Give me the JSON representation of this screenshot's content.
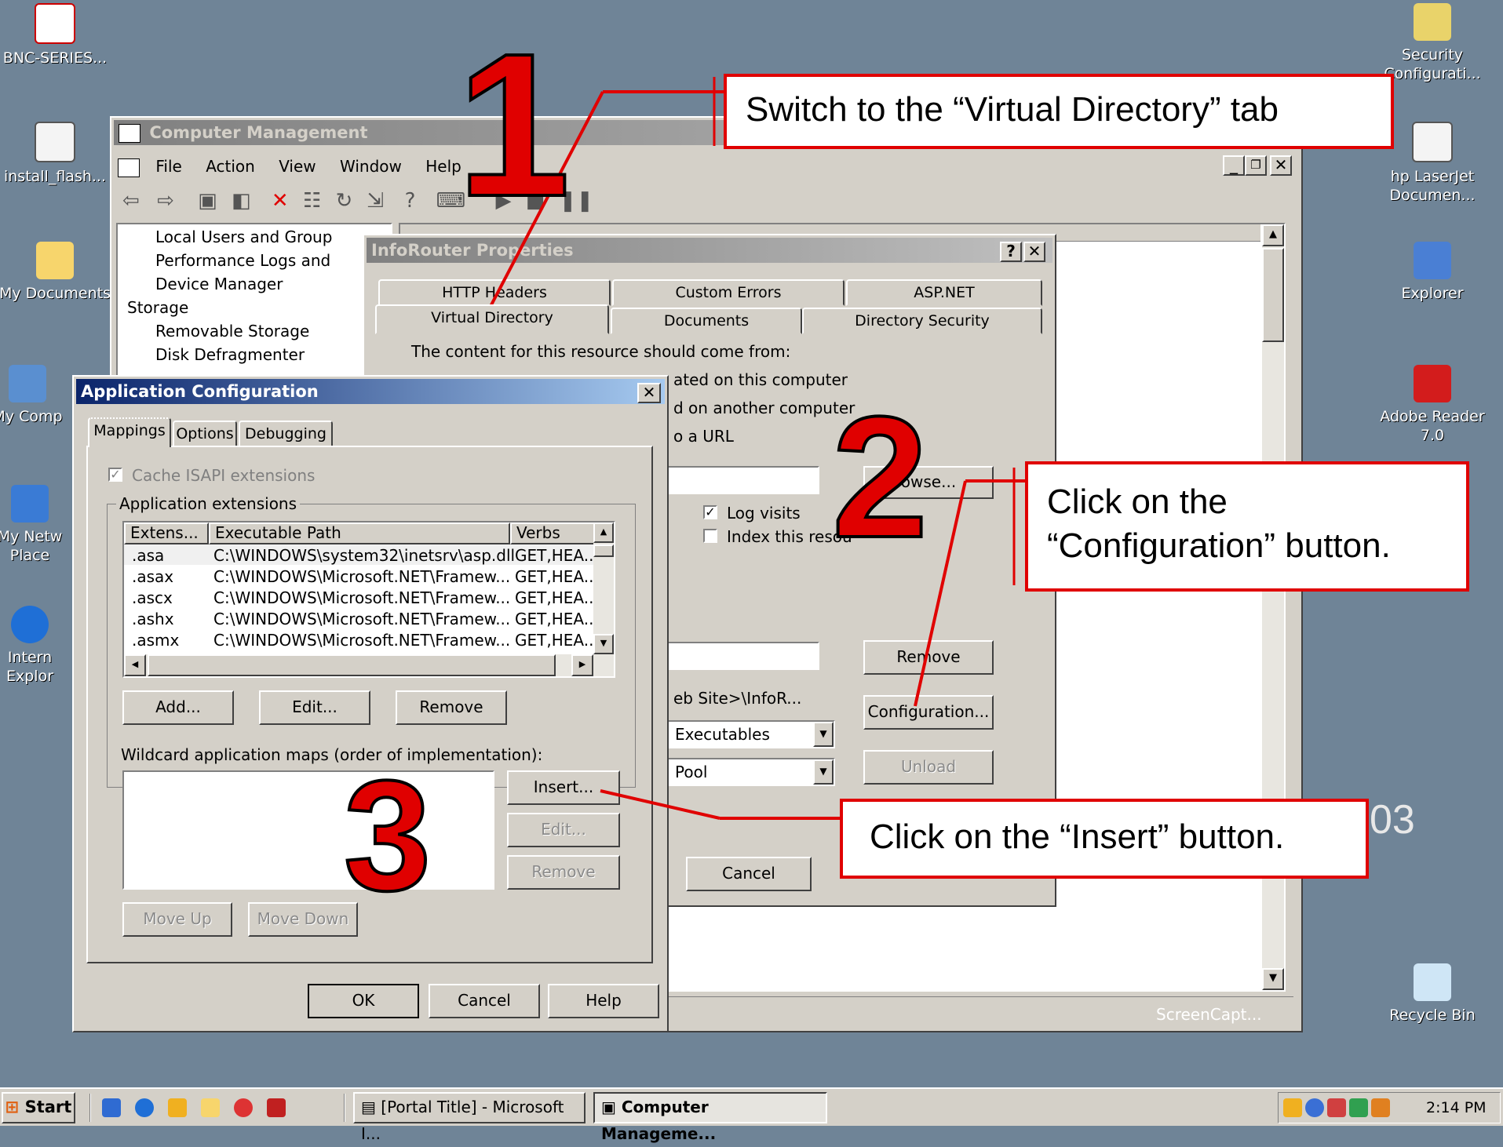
{
  "desktop_icons": [
    {
      "label": "BNC-SERIES...",
      "icon": "pdf-icon"
    },
    {
      "label": "install_flash...",
      "icon": "installer-icon"
    },
    {
      "label": "My Documents",
      "icon": "folder-icon"
    },
    {
      "label": "My Comp",
      "icon": "computer-icon"
    },
    {
      "label": "My Netw Place",
      "icon": "network-icon"
    },
    {
      "label": "Intern Explor",
      "icon": "ie-icon"
    },
    {
      "label": "Security Configurati...",
      "icon": "security-icon"
    },
    {
      "label": "hp LaserJet Documen...",
      "icon": "printer-doc-icon"
    },
    {
      "label": "Explorer",
      "icon": "explorer-icon"
    },
    {
      "label": "Adobe Reader 7.0",
      "icon": "adobe-icon"
    },
    {
      "label": "Recycle Bin",
      "icon": "recycle-bin-icon"
    }
  ],
  "computer_management": {
    "title": "Computer Management",
    "menu": [
      "File",
      "Action",
      "View",
      "Window",
      "Help"
    ],
    "tree": [
      "Local Users and Group",
      "Performance Logs and",
      "Device Manager",
      "Storage",
      "Removable Storage",
      "Disk Defragmenter"
    ],
    "status_partial": "ScreenCapt..."
  },
  "inforouter": {
    "title": "InfoRouter Properties",
    "tabs_row1": [
      "HTTP Headers",
      "Custom Errors",
      "ASP.NET"
    ],
    "tabs_row2": [
      "Virtual Directory",
      "Documents",
      "Directory Security"
    ],
    "content_label": "The content for this resource should come from:",
    "radio1": "ated on this computer",
    "radio2": "d on another computer",
    "radio3": "o a URL",
    "browse": "owse...",
    "log_visits": "Log visits",
    "index": "Index this resou",
    "remove": "Remove",
    "starting_point": "eb Site>\\InfoR...",
    "configuration": "Configuration...",
    "exec_perms": "Executables",
    "app_pool": "Pool",
    "unload": "Unload",
    "cancel": "Cancel"
  },
  "app_config": {
    "title": "Application Configuration",
    "tabs": [
      "Mappings",
      "Options",
      "Debugging"
    ],
    "cache_label": "Cache ISAPI extensions",
    "group_label": "Application extensions",
    "columns": [
      "Extens...",
      "Executable Path",
      "Verbs"
    ],
    "rows": [
      [
        ".asa",
        "C:\\WINDOWS\\system32\\inetsrv\\asp.dll",
        "GET,HEA..."
      ],
      [
        ".asax",
        "C:\\WINDOWS\\Microsoft.NET\\Framew...",
        "GET,HEA..."
      ],
      [
        ".ascx",
        "C:\\WINDOWS\\Microsoft.NET\\Framew...",
        "GET,HEA..."
      ],
      [
        ".ashx",
        "C:\\WINDOWS\\Microsoft.NET\\Framew...",
        "GET,HEA..."
      ],
      [
        ".asmx",
        "C:\\WINDOWS\\Microsoft.NET\\Framew...",
        "GET,HEA..."
      ]
    ],
    "add": "Add...",
    "edit": "Edit...",
    "remove": "Remove",
    "wildcard_label": "Wildcard application maps (order of implementation):",
    "insert": "Insert...",
    "edit2": "Edit...",
    "remove2": "Remove",
    "move_up": "Move Up",
    "move_down": "Move Down",
    "ok": "OK",
    "cancel": "Cancel",
    "help": "Help"
  },
  "callouts": {
    "step1_number": "1",
    "step1_text": "Switch to the “Virtual Directory” tab",
    "step2_number": "2",
    "step2_line1": "Click on the",
    "step2_line2": "“Configuration” button.",
    "step3_number": "3",
    "step3_text": "Click on the “Insert” button."
  },
  "background_text": "03",
  "taskbar": {
    "start": "Start",
    "task1": "[Portal Title] - Microsoft I...",
    "task2": "Computer Manageme...",
    "clock": "2:14 PM"
  },
  "colors": {
    "accent_red": "#e00000",
    "title_active": "#0a246a",
    "desktop": "#6f8497"
  }
}
